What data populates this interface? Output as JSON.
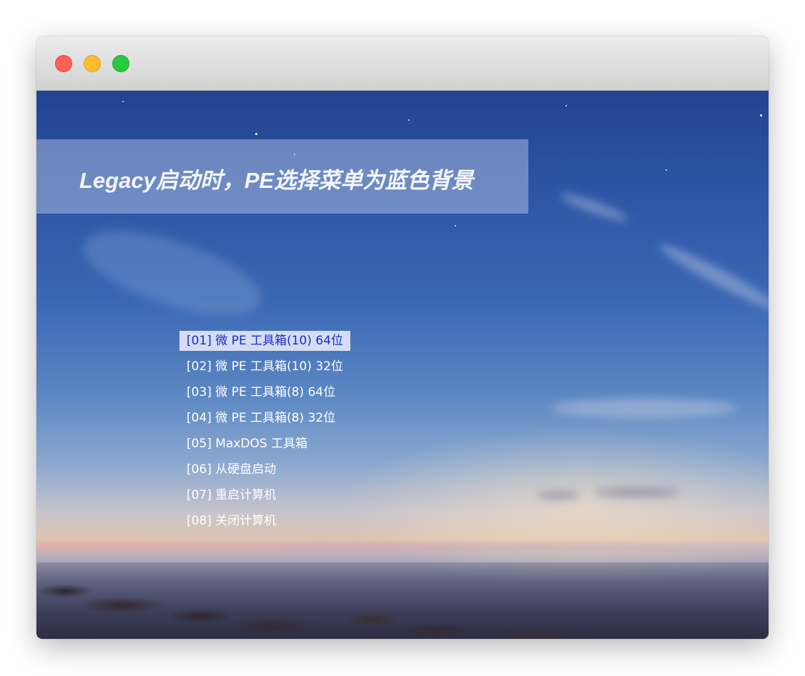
{
  "window": {
    "controls": [
      "close",
      "minimize",
      "maximize"
    ]
  },
  "banner": {
    "title": "Legacy启动时，PE选择菜单为蓝色背景"
  },
  "boot_menu": {
    "selected_index": 0,
    "items": [
      {
        "label": "[01] 微 PE 工具箱(10) 64位"
      },
      {
        "label": "[02] 微 PE 工具箱(10) 32位"
      },
      {
        "label": "[03] 微 PE 工具箱(8) 64位"
      },
      {
        "label": "[04] 微 PE 工具箱(8) 32位"
      },
      {
        "label": "[05] MaxDOS 工具箱"
      },
      {
        "label": "[06] 从硬盘启动"
      },
      {
        "label": "[07] 重启计算机"
      },
      {
        "label": "[08] 关闭计算机"
      }
    ]
  },
  "colors": {
    "selected_bg": "#d6dcf2",
    "selected_text": "#1a2bd0",
    "item_text": "#ffffff"
  }
}
